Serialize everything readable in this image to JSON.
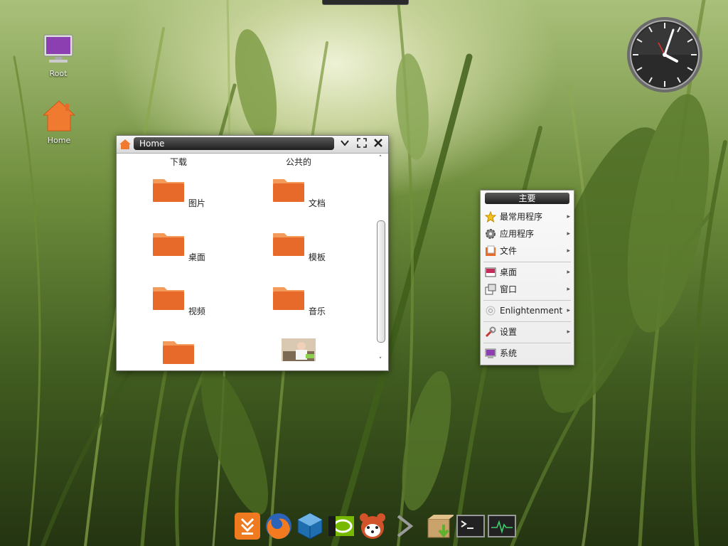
{
  "desktop": {
    "icons": [
      {
        "label": "Root",
        "icon": "computer-monitor-icon"
      },
      {
        "label": "Home",
        "icon": "home-icon"
      }
    ]
  },
  "clock": {
    "icon": "analog-clock-icon"
  },
  "file_window": {
    "title": "Home",
    "controls": {
      "minimize": "chevron-down-icon",
      "maximize": "maximize-icon",
      "close": "close-icon"
    },
    "top_labels": [
      "下载",
      "公共的"
    ],
    "items": [
      {
        "label": "图片",
        "icon": "folder-icon"
      },
      {
        "label": "文档",
        "icon": "folder-icon"
      },
      {
        "label": "桌面",
        "icon": "folder-icon"
      },
      {
        "label": "模板",
        "icon": "folder-icon"
      },
      {
        "label": "视频",
        "icon": "folder-icon"
      },
      {
        "label": "音乐",
        "icon": "folder-icon"
      },
      {
        "label": "",
        "icon": "folder-icon"
      },
      {
        "label": "",
        "icon": "image-thumbnail-icon"
      }
    ]
  },
  "menu": {
    "title": "主要",
    "items": [
      {
        "label": "最常用程序",
        "icon": "star-icon",
        "submenu": true
      },
      {
        "label": "应用程序",
        "icon": "gear-icon",
        "submenu": true
      },
      {
        "label": "文件",
        "icon": "files-icon",
        "submenu": true
      },
      {
        "label": "桌面",
        "icon": "desktop-icon",
        "submenu": true
      },
      {
        "label": "窗口",
        "icon": "windows-icon",
        "submenu": true
      },
      {
        "label": "Enlightenment",
        "icon": "enlightenment-icon",
        "submenu": true
      },
      {
        "label": "设置",
        "icon": "settings-icon",
        "submenu": true
      },
      {
        "label": "系统",
        "icon": "system-icon",
        "submenu": false
      }
    ]
  },
  "dock": {
    "items": [
      {
        "name": "download-manager-icon"
      },
      {
        "name": "firefox-icon"
      },
      {
        "name": "virtualbox-icon"
      },
      {
        "name": "nvidia-icon"
      },
      {
        "name": "red-panda-icon"
      },
      {
        "name": "arrow-right-icon"
      },
      {
        "name": "package-install-icon"
      },
      {
        "name": "terminal-icon"
      },
      {
        "name": "system-monitor-icon"
      }
    ]
  },
  "colors": {
    "folder_orange": "#e86a2a",
    "title_dark": "#1e1e1e"
  }
}
